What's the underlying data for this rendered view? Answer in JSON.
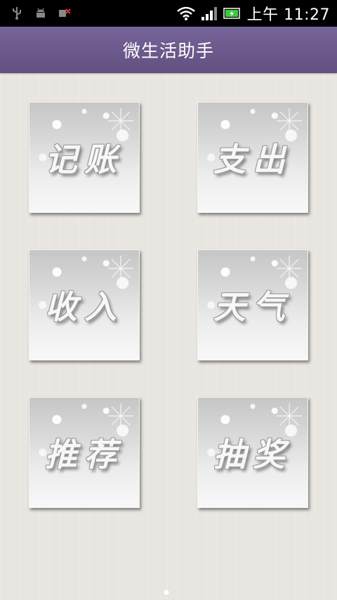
{
  "status_bar": {
    "time": "上午 11:27",
    "left_icons": [
      "usb-icon",
      "android-debug-icon",
      "sim-error-icon"
    ],
    "right_icons": [
      "wifi-icon",
      "signal-icon",
      "battery-charging-icon"
    ]
  },
  "header": {
    "title": "微生活助手",
    "color": "#6c5b8e"
  },
  "grid": {
    "tiles": [
      {
        "label": "记账"
      },
      {
        "label": "支出"
      },
      {
        "label": "收入"
      },
      {
        "label": "天气"
      },
      {
        "label": "推荐"
      },
      {
        "label": "抽奖"
      }
    ]
  },
  "pager": {
    "pages": 1,
    "current": 1
  }
}
